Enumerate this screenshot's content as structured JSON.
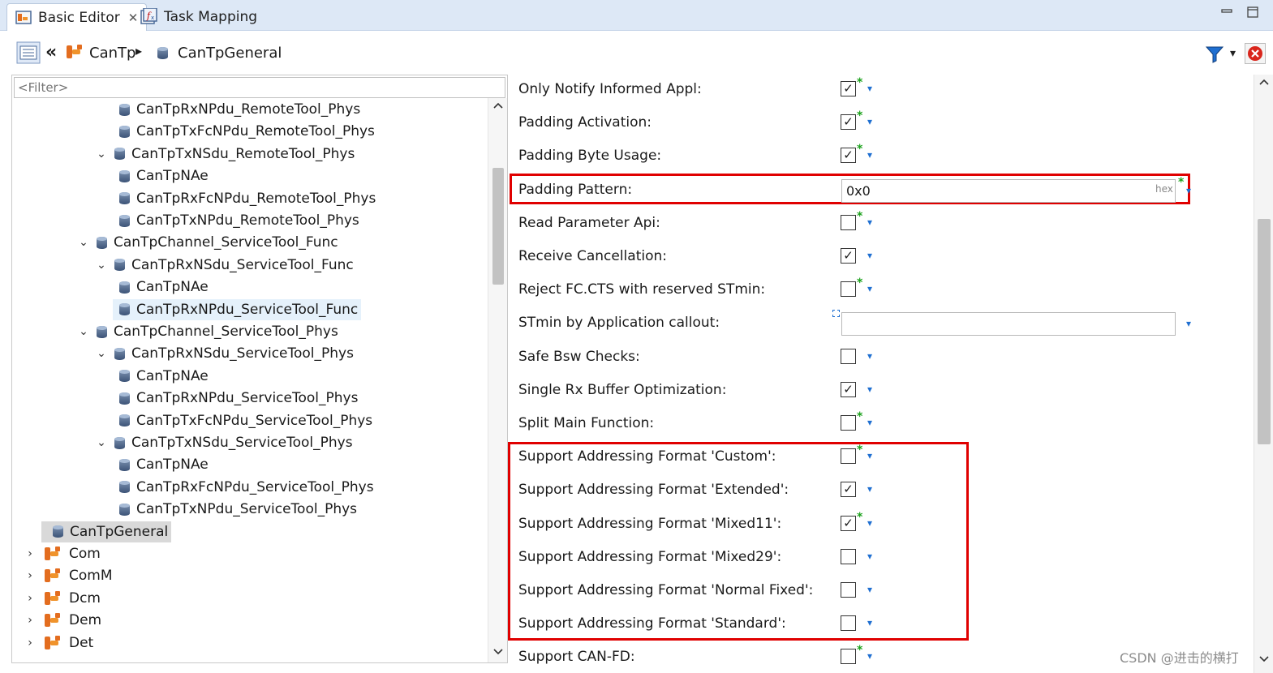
{
  "tabs": [
    {
      "label": "Basic Editor",
      "active": true,
      "closable": true,
      "icon": "basic-editor-icon"
    },
    {
      "label": "Task Mapping",
      "active": false,
      "closable": false,
      "icon": "task-mapping-icon"
    }
  ],
  "breadcrumb": {
    "back_glyph": "«",
    "module": "CanTp",
    "separator_glyph": "▸",
    "current": "CanTpGeneral"
  },
  "toolbar": {
    "filter_icon": "funnel-icon",
    "close_icon": "red-close-icon"
  },
  "filter": {
    "placeholder": "<Filter>",
    "value": ""
  },
  "tree": [
    {
      "label": "CanTpRxNPdu_RemoteTool_Phys",
      "level": 3,
      "twisty": "",
      "icon": "db"
    },
    {
      "label": "CanTpTxFcNPdu_RemoteTool_Phys",
      "level": 3,
      "twisty": "",
      "icon": "db"
    },
    {
      "label": "CanTpTxNSdu_RemoteTool_Phys",
      "level": 2,
      "twisty": "⌄",
      "icon": "db"
    },
    {
      "label": "CanTpNAe",
      "level": 3,
      "twisty": "",
      "icon": "db"
    },
    {
      "label": "CanTpRxFcNPdu_RemoteTool_Phys",
      "level": 3,
      "twisty": "",
      "icon": "db"
    },
    {
      "label": "CanTpTxNPdu_RemoteTool_Phys",
      "level": 3,
      "twisty": "",
      "icon": "db"
    },
    {
      "label": "CanTpChannel_ServiceTool_Func",
      "level": 1,
      "twisty": "⌄",
      "icon": "db"
    },
    {
      "label": "CanTpRxNSdu_ServiceTool_Func",
      "level": 2,
      "twisty": "⌄",
      "icon": "db"
    },
    {
      "label": "CanTpNAe",
      "level": 3,
      "twisty": "",
      "icon": "db"
    },
    {
      "label": "CanTpRxNPdu_ServiceTool_Func",
      "level": 3,
      "twisty": "",
      "icon": "db",
      "highlight": "light"
    },
    {
      "label": "CanTpChannel_ServiceTool_Phys",
      "level": 1,
      "twisty": "⌄",
      "icon": "db"
    },
    {
      "label": "CanTpRxNSdu_ServiceTool_Phys",
      "level": 2,
      "twisty": "⌄",
      "icon": "db"
    },
    {
      "label": "CanTpNAe",
      "level": 3,
      "twisty": "",
      "icon": "db"
    },
    {
      "label": "CanTpRxNPdu_ServiceTool_Phys",
      "level": 3,
      "twisty": "",
      "icon": "db"
    },
    {
      "label": "CanTpTxFcNPdu_ServiceTool_Phys",
      "level": 3,
      "twisty": "",
      "icon": "db"
    },
    {
      "label": "CanTpTxNSdu_ServiceTool_Phys",
      "level": 2,
      "twisty": "⌄",
      "icon": "db"
    },
    {
      "label": "CanTpNAe",
      "level": 3,
      "twisty": "",
      "icon": "db"
    },
    {
      "label": "CanTpRxFcNPdu_ServiceTool_Phys",
      "level": 3,
      "twisty": "",
      "icon": "db"
    },
    {
      "label": "CanTpTxNPdu_ServiceTool_Phys",
      "level": 3,
      "twisty": "",
      "icon": "db"
    },
    {
      "label": "CanTpGeneral",
      "level": 0,
      "twisty": "",
      "icon": "db",
      "highlight": "gray"
    },
    {
      "label": "Com",
      "level": -1,
      "twisty": "›",
      "icon": "module"
    },
    {
      "label": "ComM",
      "level": -1,
      "twisty": "›",
      "icon": "module"
    },
    {
      "label": "Dcm",
      "level": -1,
      "twisty": "›",
      "icon": "module"
    },
    {
      "label": "Dem",
      "level": -1,
      "twisty": "›",
      "icon": "module"
    },
    {
      "label": "Det",
      "level": -1,
      "twisty": "›",
      "icon": "module"
    }
  ],
  "properties": [
    {
      "label": "Only Notify Informed Appl:",
      "type": "checkbox",
      "checked": true,
      "modified": true
    },
    {
      "label": "Padding Activation:",
      "type": "checkbox",
      "checked": true,
      "modified": true
    },
    {
      "label": "Padding Byte Usage:",
      "type": "checkbox",
      "checked": true,
      "modified": true
    },
    {
      "label": "Padding Pattern:",
      "type": "text",
      "value": "0x0",
      "suffix": "hex",
      "modified": true
    },
    {
      "label": "Read Parameter Api:",
      "type": "checkbox",
      "checked": false,
      "modified": true
    },
    {
      "label": "Receive Cancellation:",
      "type": "checkbox",
      "checked": true,
      "modified": false
    },
    {
      "label": "Reject FC.CTS with reserved STmin:",
      "type": "checkbox",
      "checked": false,
      "modified": true
    },
    {
      "label": "STmin by Application callout:",
      "type": "text",
      "value": "",
      "suffix": "",
      "modified": false
    },
    {
      "label": "Safe Bsw Checks:",
      "type": "checkbox",
      "checked": false,
      "modified": false
    },
    {
      "label": "Single Rx Buffer Optimization:",
      "type": "checkbox",
      "checked": true,
      "modified": false
    },
    {
      "label": "Split Main Function:",
      "type": "checkbox",
      "checked": false,
      "modified": true
    },
    {
      "label": "Support Addressing Format 'Custom':",
      "type": "checkbox",
      "checked": false,
      "modified": true
    },
    {
      "label": "Support Addressing Format 'Extended':",
      "type": "checkbox",
      "checked": true,
      "modified": false
    },
    {
      "label": "Support Addressing Format 'Mixed11':",
      "type": "checkbox",
      "checked": true,
      "modified": true
    },
    {
      "label": "Support Addressing Format 'Mixed29':",
      "type": "checkbox",
      "checked": false,
      "modified": false
    },
    {
      "label": "Support Addressing Format 'Normal Fixed':",
      "type": "checkbox",
      "checked": false,
      "modified": false
    },
    {
      "label": "Support Addressing Format 'Standard':",
      "type": "checkbox",
      "checked": false,
      "modified": false
    },
    {
      "label": "Support CAN-FD:",
      "type": "checkbox",
      "checked": false,
      "modified": true
    }
  ],
  "glyphs": {
    "check": "✓",
    "asterisk": "*",
    "dropdown": "▾",
    "hex": "hex",
    "close": "✕"
  },
  "colors": {
    "highlight_box": "#e00000",
    "modified_asterisk": "#1aa11a",
    "dropdown": "#1f6fd1",
    "tab_bar": "#dde8f6"
  },
  "watermark": "CSDN @进击的横打"
}
